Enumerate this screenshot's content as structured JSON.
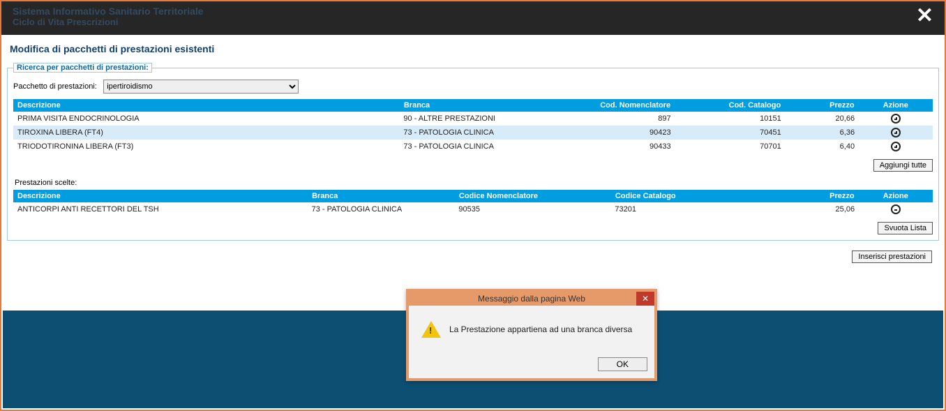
{
  "app": {
    "title": "Sistema Informativo Sanitario Territoriale",
    "subtitle": "Ciclo di Vita Prescrizioni"
  },
  "page": {
    "heading": "Modifica di pacchetti di prestazioni esistenti"
  },
  "search": {
    "legend": "Ricerca per pacchetti di prestazioni:",
    "label": "Pacchetto di prestazioni:",
    "selected": "ipertiroidismo"
  },
  "available": {
    "headers": {
      "descrizione": "Descrizione",
      "branca": "Branca",
      "cod_nomenclatore": "Cod. Nomenclatore",
      "cod_catalogo": "Cod. Catalogo",
      "prezzo": "Prezzo",
      "azione": "Azione"
    },
    "rows": [
      {
        "descrizione": "PRIMA VISITA ENDOCRINOLOGIA",
        "branca": "90 - ALTRE PRESTAZIONI",
        "cod_nomenclatore": "897",
        "cod_catalogo": "10151",
        "prezzo": "20,66"
      },
      {
        "descrizione": "TIROXINA LIBERA (FT4)",
        "branca": "73 - PATOLOGIA CLINICA",
        "cod_nomenclatore": "90423",
        "cod_catalogo": "70451",
        "prezzo": "6,36"
      },
      {
        "descrizione": "TRIODOTIRONINA LIBERA (FT3)",
        "branca": "73 - PATOLOGIA CLINICA",
        "cod_nomenclatore": "90433",
        "cod_catalogo": "70701",
        "prezzo": "6,40"
      }
    ],
    "add_all_label": "Aggiungi tutte"
  },
  "selected": {
    "label": "Prestazioni scelte:",
    "headers": {
      "descrizione": "Descrizione",
      "branca": "Branca",
      "codice_nomenclatore": "Codice Nomenclatore",
      "codice_catalogo": "Codice Catalogo",
      "prezzo": "Prezzo",
      "azione": "Azione"
    },
    "rows": [
      {
        "descrizione": "ANTICORPI ANTI RECETTORI DEL TSH",
        "branca": "73 - PATOLOGIA CLINICA",
        "codice_nomenclatore": "90535",
        "codice_catalogo": "73201",
        "prezzo": "25,06"
      }
    ],
    "clear_label": "Svuota Lista"
  },
  "actions": {
    "insert_label": "Inserisci prestazioni"
  },
  "dialog": {
    "title": "Messaggio dalla pagina Web",
    "message": "La Prestazione appartiena ad una branca diversa",
    "ok": "OK"
  }
}
